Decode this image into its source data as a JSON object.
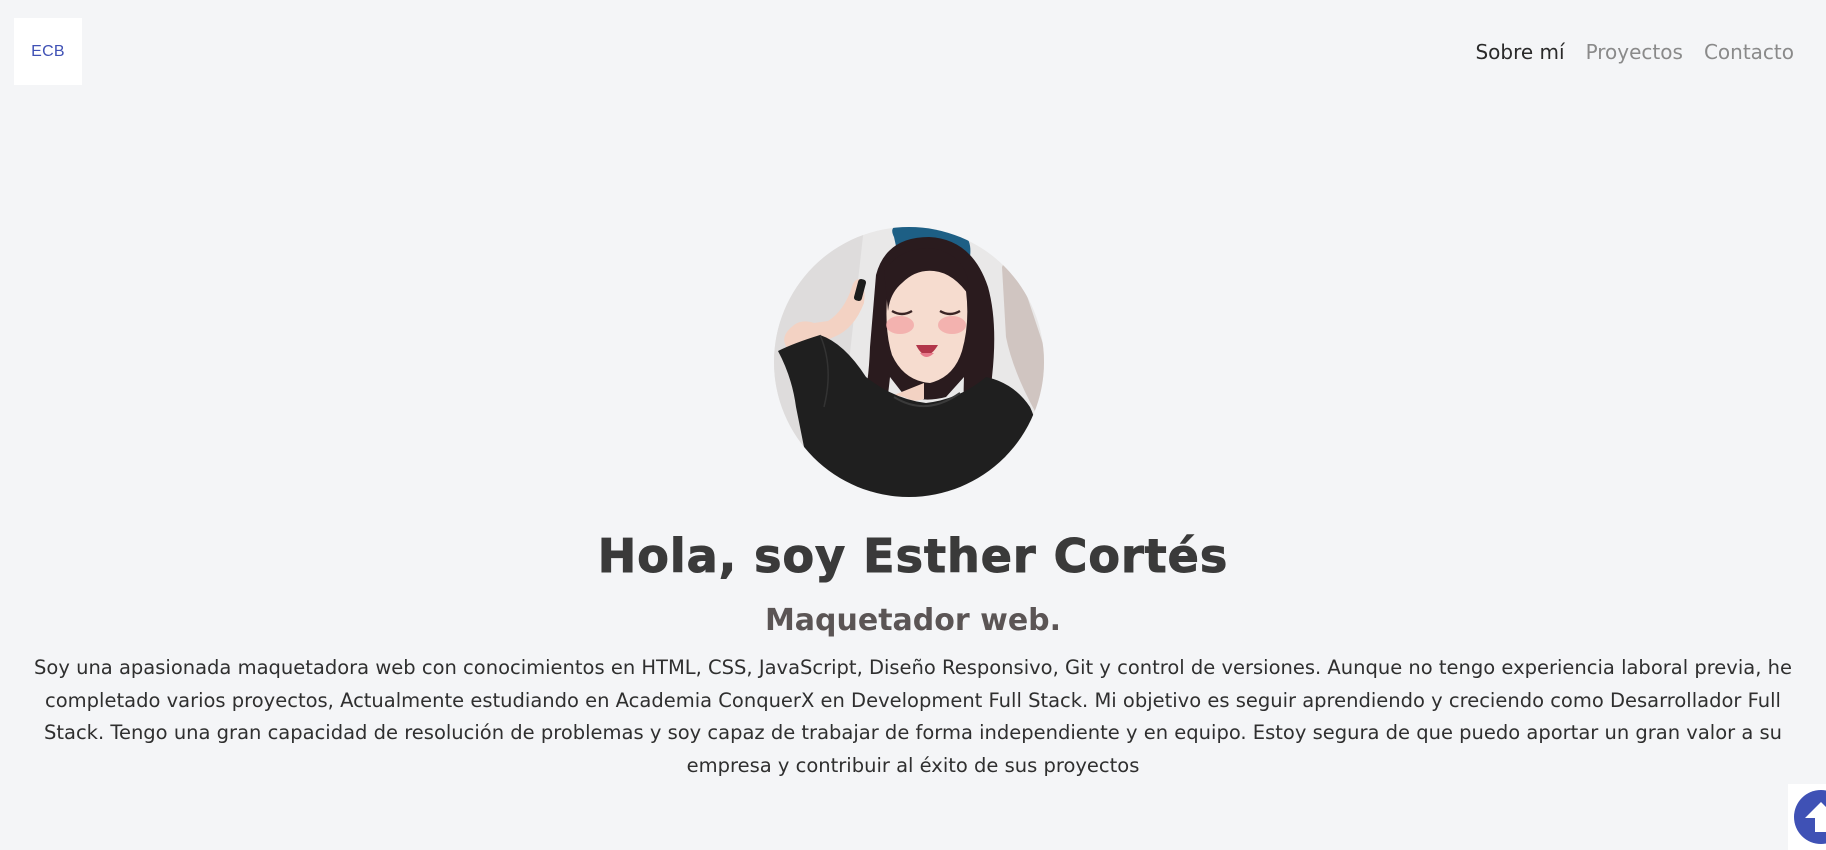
{
  "header": {
    "logo_text": "ECB",
    "nav": [
      {
        "label": "Sobre mí",
        "active": true
      },
      {
        "label": "Proyectos",
        "active": false
      },
      {
        "label": "Contacto",
        "active": false
      }
    ]
  },
  "hero": {
    "title": "Hola, soy Esther Cortés",
    "subtitle": "Maquetador web.",
    "bio": "Soy una apasionada maquetadora web con conocimientos en HTML, CSS, JavaScript, Diseño Responsivo, Git y control de versiones. Aunque no tengo experiencia laboral previa, he completado varios proyectos, Actualmente estudiando en Academia ConquerX en Development Full Stack. Mi objetivo es seguir aprendiendo y creciendo como Desarrollador Full Stack. Tengo una gran capacidad de resolución de problemas y soy capaz de trabajar de forma independiente y en equipo. Estoy segura de que puedo aportar un gran valor a su empresa y contribuir al éxito de sus proyectos"
  },
  "icons": {
    "scroll_top": "arrow-up-icon"
  },
  "colors": {
    "accent": "#3f51b5",
    "background": "#f4f5f7"
  }
}
